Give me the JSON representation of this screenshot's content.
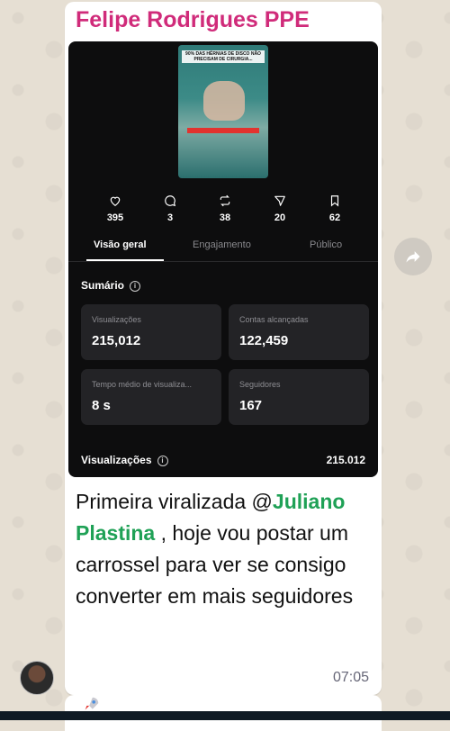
{
  "chat": {
    "sender": "Felipe Rodrigues PPE",
    "time": "07:05",
    "message_part1": "Primeira viralizada @",
    "mention": "Juliano Plastina",
    "message_part2": " , hoje vou postar um carrossel para ver se consigo converter em mais seguidores"
  },
  "post": {
    "thumbnail_caption": "90% DAS HÉRNIAS DE DISCO NÃO PRECISAM DE CIRURGIA...",
    "stats": [
      {
        "icon": "heart-icon",
        "value": "395"
      },
      {
        "icon": "comment-icon",
        "value": "3"
      },
      {
        "icon": "repost-icon",
        "value": "38"
      },
      {
        "icon": "share-icon",
        "value": "20"
      },
      {
        "icon": "bookmark-icon",
        "value": "62"
      }
    ]
  },
  "tabs": [
    {
      "label": "Visão geral",
      "active": true
    },
    {
      "label": "Engajamento",
      "active": false
    },
    {
      "label": "Público",
      "active": false
    }
  ],
  "summary": {
    "title": "Sumário",
    "metrics": [
      {
        "label": "Visualizações",
        "value": "215,012"
      },
      {
        "label": "Contas alcançadas",
        "value": "122,459"
      },
      {
        "label": "Tempo médio de visualiza...",
        "value": "8 s"
      },
      {
        "label": "Seguidores",
        "value": "167"
      }
    ],
    "views_label": "Visualizações",
    "views_value": "215.012"
  },
  "colors": {
    "sender": "#d02b7a",
    "mention": "#1fa156",
    "card_bg": "#0d0d0e"
  }
}
